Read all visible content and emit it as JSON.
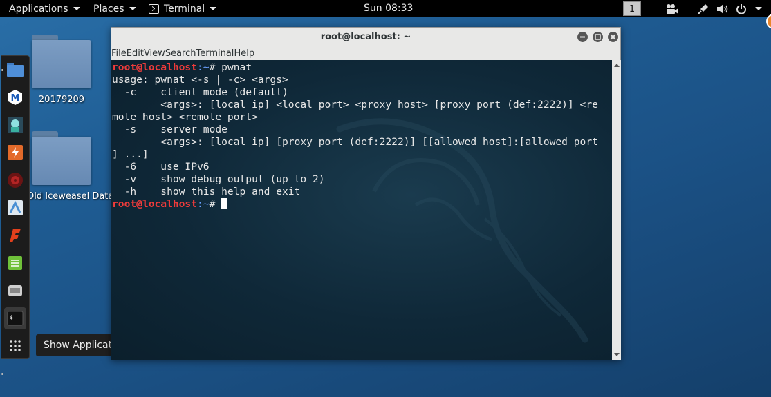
{
  "topbar": {
    "applications": "Applications",
    "places": "Places",
    "terminal": "Terminal",
    "clock": "Sun 08:33",
    "workspace": "1"
  },
  "desktop": {
    "icons": [
      {
        "label": "20179209",
        "icon": "folder-icon"
      },
      {
        "label": "Old Iceweasel Data",
        "icon": "folder-icon"
      }
    ]
  },
  "dock": {
    "items": [
      {
        "name": "files-icon",
        "color": "#3f7cc4"
      },
      {
        "name": "maltego-icon",
        "color": "#1a5bb8"
      },
      {
        "name": "armitage-icon",
        "color": "#3ab0a0"
      },
      {
        "name": "burpsuite-icon",
        "color": "#e36a2a"
      },
      {
        "name": "metasploit-icon",
        "color": "#b32424"
      },
      {
        "name": "beef-icon",
        "color": "#4a8fd4"
      },
      {
        "name": "faraday-icon",
        "color": "#e2401c"
      },
      {
        "name": "notes-icon",
        "color": "#6fc13a"
      },
      {
        "name": "keyboard-icon",
        "color": "#9a9a9a"
      },
      {
        "name": "terminal-icon",
        "color": "#111111"
      },
      {
        "name": "show-applications-icon",
        "color": "#dddddd"
      }
    ],
    "tooltip": "Show Applications"
  },
  "window": {
    "title": "root@localhost: ~",
    "menu": [
      "File",
      "Edit",
      "View",
      "Search",
      "Terminal",
      "Help"
    ]
  },
  "terminal": {
    "user_host": "root@localhost",
    "path": ":~",
    "prompt_symbol": "# ",
    "command": "pwnat",
    "output": [
      "usage: pwnat <-s | -c> <args>",
      "  -c    client mode (default)",
      "        <args>: [local ip] <local port> <proxy host> [proxy port (def:2222)] <re",
      "mote host> <remote port>",
      "  -s    server mode",
      "        <args>: [local ip] [proxy port (def:2222)] [[allowed host]:[allowed port",
      "] ...]",
      "  -6    use IPv6",
      "  -v    show debug output (up to 2)",
      "  -h    show this help and exit"
    ]
  },
  "colors": {
    "prompt_user": "#ef3b3b",
    "prompt_path": "#6aa0ff",
    "terminal_bg": "#0f2838",
    "desktop_bg": "#1f5d94"
  }
}
